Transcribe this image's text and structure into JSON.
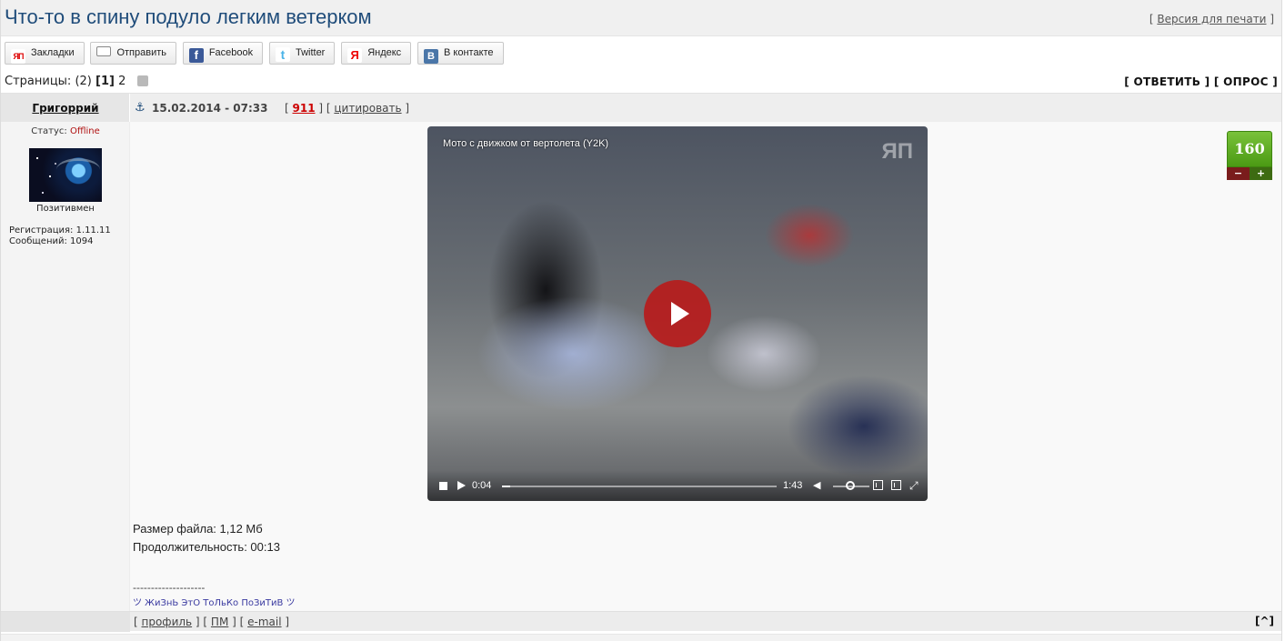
{
  "topic": {
    "title": "Что-то в спину подуло легким ветерком",
    "print_open": "[",
    "print_label": "Версия для печати",
    "print_close": "]"
  },
  "share": [
    {
      "label": "Закладки",
      "icon": "yap-bookmarks-icon",
      "glyph": "ЯП"
    },
    {
      "label": "Отправить",
      "icon": "envelope-icon",
      "glyph": ""
    },
    {
      "label": "Facebook",
      "icon": "facebook-icon",
      "glyph": "f"
    },
    {
      "label": "Twitter",
      "icon": "twitter-icon",
      "glyph": "t"
    },
    {
      "label": "Яндекс",
      "icon": "yandex-icon",
      "glyph": "Я"
    },
    {
      "label": "В контакте",
      "icon": "vkontakte-icon",
      "glyph": "B"
    }
  ],
  "pagination": {
    "label": "Страницы:",
    "count": "(2)",
    "current": "[1]",
    "next": "2"
  },
  "actions": {
    "reply": "[ ОТВЕТИТЬ ]",
    "poll": "[ ОПРОС ]"
  },
  "post": {
    "author": "Григоррий",
    "date": "15.02.2014 - 07:33",
    "number": "911",
    "quote": "цитировать",
    "status_label": "Статус:",
    "status_value": "Offline",
    "rank": "Позитивмен",
    "registration": "Регистрация: 1.11.11",
    "messages": "Сообщений: 1094",
    "rating": "160",
    "rating_minus": "−",
    "rating_plus": "+",
    "file_size": "Размер файла: 1,12 Мб",
    "duration": "Продолжительность: 00:13",
    "sig_separator": "--------------------",
    "signature": "ツ ЖиЗнЬ ЭтО ТоЛьКо ПоЗиТиВ ツ"
  },
  "video": {
    "title": "Мото с движком от вертолета (Y2K)",
    "logo": "ЯП",
    "current_time": "0:04",
    "total_time": "1:43",
    "progress": 0.03,
    "volume": 0.5
  },
  "footer": {
    "profile": "профиль",
    "pm": "ПМ",
    "email": "e-mail",
    "to_top": "[^]"
  }
}
